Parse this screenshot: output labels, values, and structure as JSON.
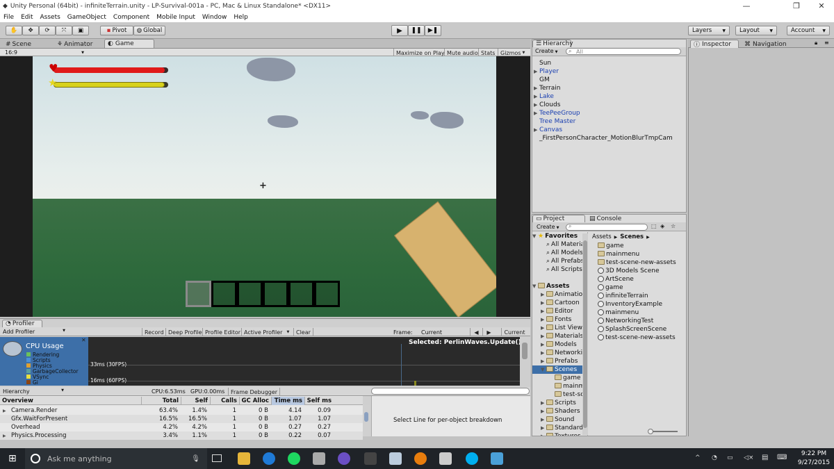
{
  "window": {
    "title": "Unity Personal (64bit) - infiniteTerrain.unity - LP-Survival-001a - PC, Mac & Linux Standalone* <DX11>",
    "minimize": "—",
    "maximize": "❐",
    "close": "✕"
  },
  "menu": [
    "File",
    "Edit",
    "Assets",
    "GameObject",
    "Component",
    "Mobile Input",
    "Window",
    "Help"
  ],
  "toolbar": {
    "pivot": "Pivot",
    "global": "Global",
    "layers": "Layers",
    "layout": "Layout",
    "account": "Account"
  },
  "scene_tabs": {
    "scene": "Scene",
    "animator": "Animator",
    "game": "Game",
    "aspect": "16:9",
    "maximize_on_play": "Maximize on Play",
    "mute_audio": "Mute audio",
    "stats": "Stats",
    "gizmos": "Gizmos"
  },
  "hud": {
    "health_fraction": 0.97,
    "stamina_fraction": 0.97,
    "colors": {
      "health": "#e01a1a",
      "stamina": "#d8d21c",
      "sky": "#e7eeec",
      "ground": "#2e6a3c",
      "arm": "#d7b26e"
    },
    "hotbar_slots": 6,
    "crosshair": "+"
  },
  "hierarchy": {
    "tab": "Hierarchy",
    "create": "Create",
    "search_placeholder": "All",
    "items": [
      {
        "label": "Sun",
        "has_children": false,
        "prefab": false
      },
      {
        "label": "Player",
        "has_children": true,
        "prefab": true
      },
      {
        "label": "GM",
        "has_children": false,
        "prefab": false
      },
      {
        "label": "Terrain",
        "has_children": true,
        "prefab": false
      },
      {
        "label": "Lake",
        "has_children": true,
        "prefab": true
      },
      {
        "label": "Clouds",
        "has_children": true,
        "prefab": false
      },
      {
        "label": "TeePeeGroup",
        "has_children": true,
        "prefab": true
      },
      {
        "label": "Tree Master",
        "has_children": false,
        "prefab": true
      },
      {
        "label": "Canvas",
        "has_children": true,
        "prefab": true
      },
      {
        "label": "_FirstPersonCharacter_MotionBlurTmpCam",
        "has_children": false,
        "prefab": false
      }
    ]
  },
  "inspector": {
    "tab": "Inspector",
    "navigation": "Navigation"
  },
  "project": {
    "tab": "Project",
    "console": "Console",
    "create": "Create",
    "breadcrumb_root": "Assets",
    "breadcrumb_current": "Scenes",
    "favorites_label": "Favorites",
    "favorites": [
      "All Materials",
      "All Models",
      "All Prefabs",
      "All Scripts"
    ],
    "assets_label": "Assets",
    "folders": [
      "Animations",
      "Cartoon",
      "Editor",
      "Fonts",
      "List View",
      "Materials",
      "Models",
      "Networking",
      "Prefabs",
      "Scenes",
      "Scripts",
      "Shaders",
      "Sound",
      "Standard",
      "Textures"
    ],
    "scene_children": [
      "game",
      "mainmenu",
      "test-scene"
    ],
    "contents": [
      {
        "label": "game",
        "kind": "folder"
      },
      {
        "label": "mainmenu",
        "kind": "folder"
      },
      {
        "label": "test-scene-new-assets",
        "kind": "folder"
      },
      {
        "label": "3D Models Scene",
        "kind": "scene"
      },
      {
        "label": "ArtScene",
        "kind": "scene"
      },
      {
        "label": "game",
        "kind": "scene"
      },
      {
        "label": "infiniteTerrain",
        "kind": "scene"
      },
      {
        "label": "InventoryExample",
        "kind": "scene"
      },
      {
        "label": "mainmenu",
        "kind": "scene"
      },
      {
        "label": "NetworkingTest",
        "kind": "scene"
      },
      {
        "label": "SplashScreenScene",
        "kind": "scene"
      },
      {
        "label": "test-scene-new-assets",
        "kind": "scene"
      }
    ]
  },
  "profiler": {
    "tab": "Profiler",
    "add_profiler": "Add Profiler",
    "record": "Record",
    "deep_profile": "Deep Profile",
    "profile_editor": "Profile Editor",
    "active_profiler": "Active Profiler",
    "clear": "Clear",
    "frame_label": "Frame:",
    "frame_value": "Current",
    "current_btn": "Current",
    "cpu_usage": "CPU Usage",
    "legend": [
      {
        "label": "Rendering",
        "color": "#6cc15a"
      },
      {
        "label": "Scripts",
        "color": "#4a90d9"
      },
      {
        "label": "Physics",
        "color": "#e0a030"
      },
      {
        "label": "GarbageCollector",
        "color": "#5aa0a0"
      },
      {
        "label": "VSync",
        "color": "#e8e040"
      },
      {
        "label": "Gi",
        "color": "#8b4513"
      }
    ],
    "line_30fps": "33ms (30FPS)",
    "line_60fps": "16ms (60FPS)",
    "selected": "Selected: PerlinWaves.Update()",
    "hierarchy_dropdown": "Hierarchy",
    "cpu_stat": "CPU:6.53ms",
    "gpu_stat": "GPU:0.00ms",
    "frame_debugger": "Frame Debugger",
    "columns": [
      "Overview",
      "Total",
      "Self",
      "Calls",
      "GC Alloc",
      "Time ms",
      "Self ms"
    ],
    "rows": [
      {
        "name": "Camera.Render",
        "expandable": true,
        "total": "63.4%",
        "self": "1.4%",
        "calls": "1",
        "gc": "0 B",
        "time": "4.14",
        "selfms": "0.09"
      },
      {
        "name": "Gfx.WaitForPresent",
        "expandable": false,
        "total": "16.5%",
        "self": "16.5%",
        "calls": "1",
        "gc": "0 B",
        "time": "1.07",
        "selfms": "1.07"
      },
      {
        "name": "Overhead",
        "expandable": false,
        "total": "4.2%",
        "self": "4.2%",
        "calls": "1",
        "gc": "0 B",
        "time": "0.27",
        "selfms": "0.27"
      },
      {
        "name": "Physics.Processing",
        "expandable": true,
        "total": "3.4%",
        "self": "1.1%",
        "calls": "1",
        "gc": "0 B",
        "time": "0.22",
        "selfms": "0.07"
      }
    ],
    "detail_hint": "Select Line for per-object breakdown"
  },
  "taskbar": {
    "search_placeholder": "Ask me anything",
    "time": "9:22 PM",
    "date": "9/27/2015"
  }
}
